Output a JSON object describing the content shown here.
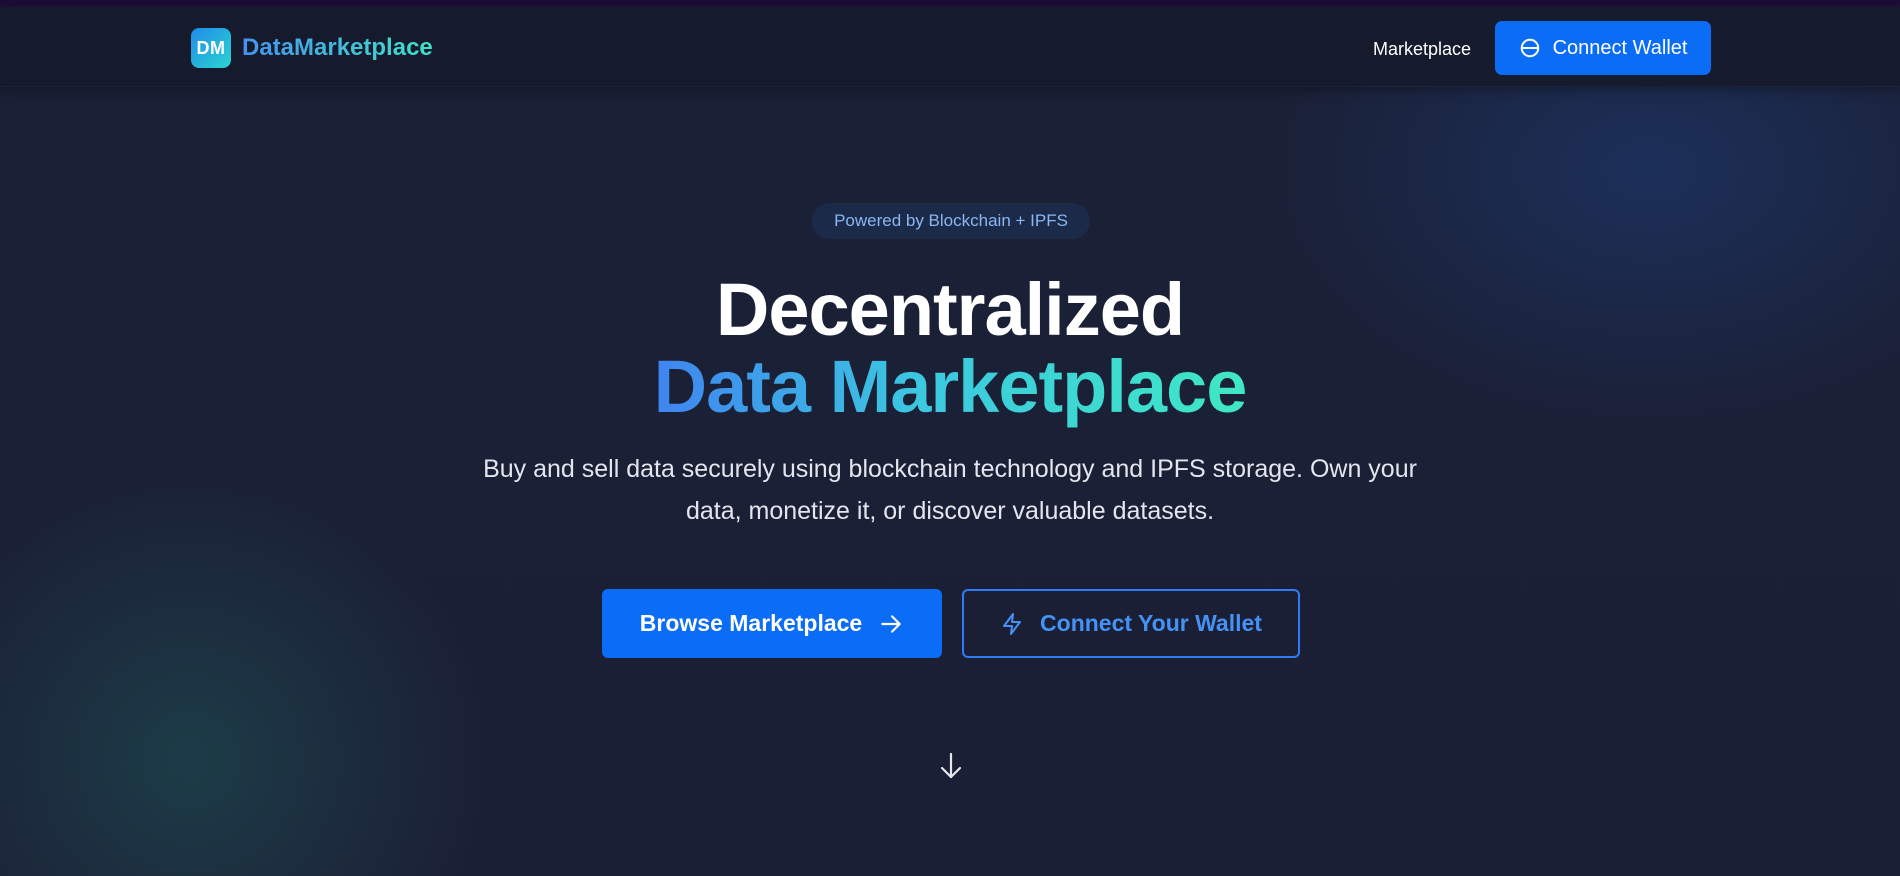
{
  "colors": {
    "accent": "#0b6cf5",
    "gradient_start": "#3f84f0",
    "gradient_end": "#3fe8c4",
    "background": "#1a2035",
    "navbar": "#151a2c"
  },
  "navbar": {
    "logo_text": "DM",
    "brand_name": "DataMarketplace",
    "links": [
      {
        "label": "Marketplace"
      }
    ],
    "connect_button": {
      "label": "Connect Wallet",
      "icon": "wallet-icon"
    }
  },
  "hero": {
    "badge": "Powered by Blockchain + IPFS",
    "title_line1": "Decentralized",
    "title_line2": "Data Marketplace",
    "subtitle": "Buy and sell data securely using blockchain technology and IPFS storage. Own your data, monetize it, or discover valuable datasets.",
    "primary_button": {
      "label": "Browse Marketplace",
      "icon": "arrow-right-icon"
    },
    "secondary_button": {
      "label": "Connect Your Wallet",
      "icon": "lightning-icon"
    },
    "scroll_icon": "arrow-down-icon"
  }
}
